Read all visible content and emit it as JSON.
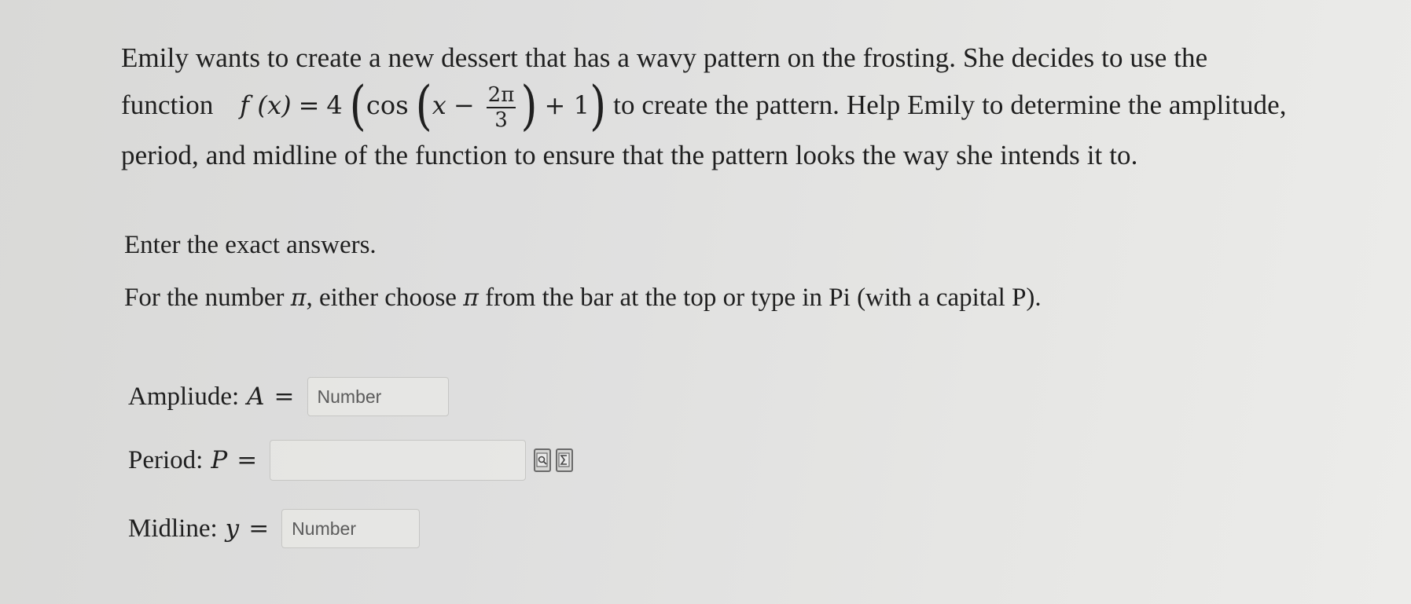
{
  "problem": {
    "line1": "Emily wants to create a new dessert that has a wavy pattern on the frosting. She decides to use the",
    "line2_prefix": "function",
    "function_lhs": "f (x)",
    "function_eq": "=",
    "function_coef": "4",
    "function_cos": "cos",
    "function_x": "x",
    "function_minus": "−",
    "frac_num": "2π",
    "frac_den": "3",
    "function_plus_one": "+ 1",
    "line2_suffix": "to create the pattern. Help Emily to determine the amplitude,",
    "line3": "period, and midline of the function to ensure that the pattern looks the way she intends it to."
  },
  "instructions": {
    "exact": "Enter the exact answers.",
    "pi_a": "For the number ",
    "pi_sym1": "π",
    "pi_b": ", either choose ",
    "pi_sym2": "π",
    "pi_c": " from the bar at the top or type in Pi (with a capital P)."
  },
  "answers": {
    "amplitude": {
      "label": "Ampliude:",
      "var": "A",
      "eq": "=",
      "placeholder": "Number",
      "value": ""
    },
    "period": {
      "label": "Period:",
      "var": "P",
      "eq": "=",
      "placeholder": "",
      "value": ""
    },
    "midline": {
      "label": "Midline:",
      "var": "y",
      "eq": "=",
      "placeholder": "Number",
      "value": ""
    }
  },
  "period_tools": [
    "preview-icon",
    "equation-editor-icon"
  ]
}
